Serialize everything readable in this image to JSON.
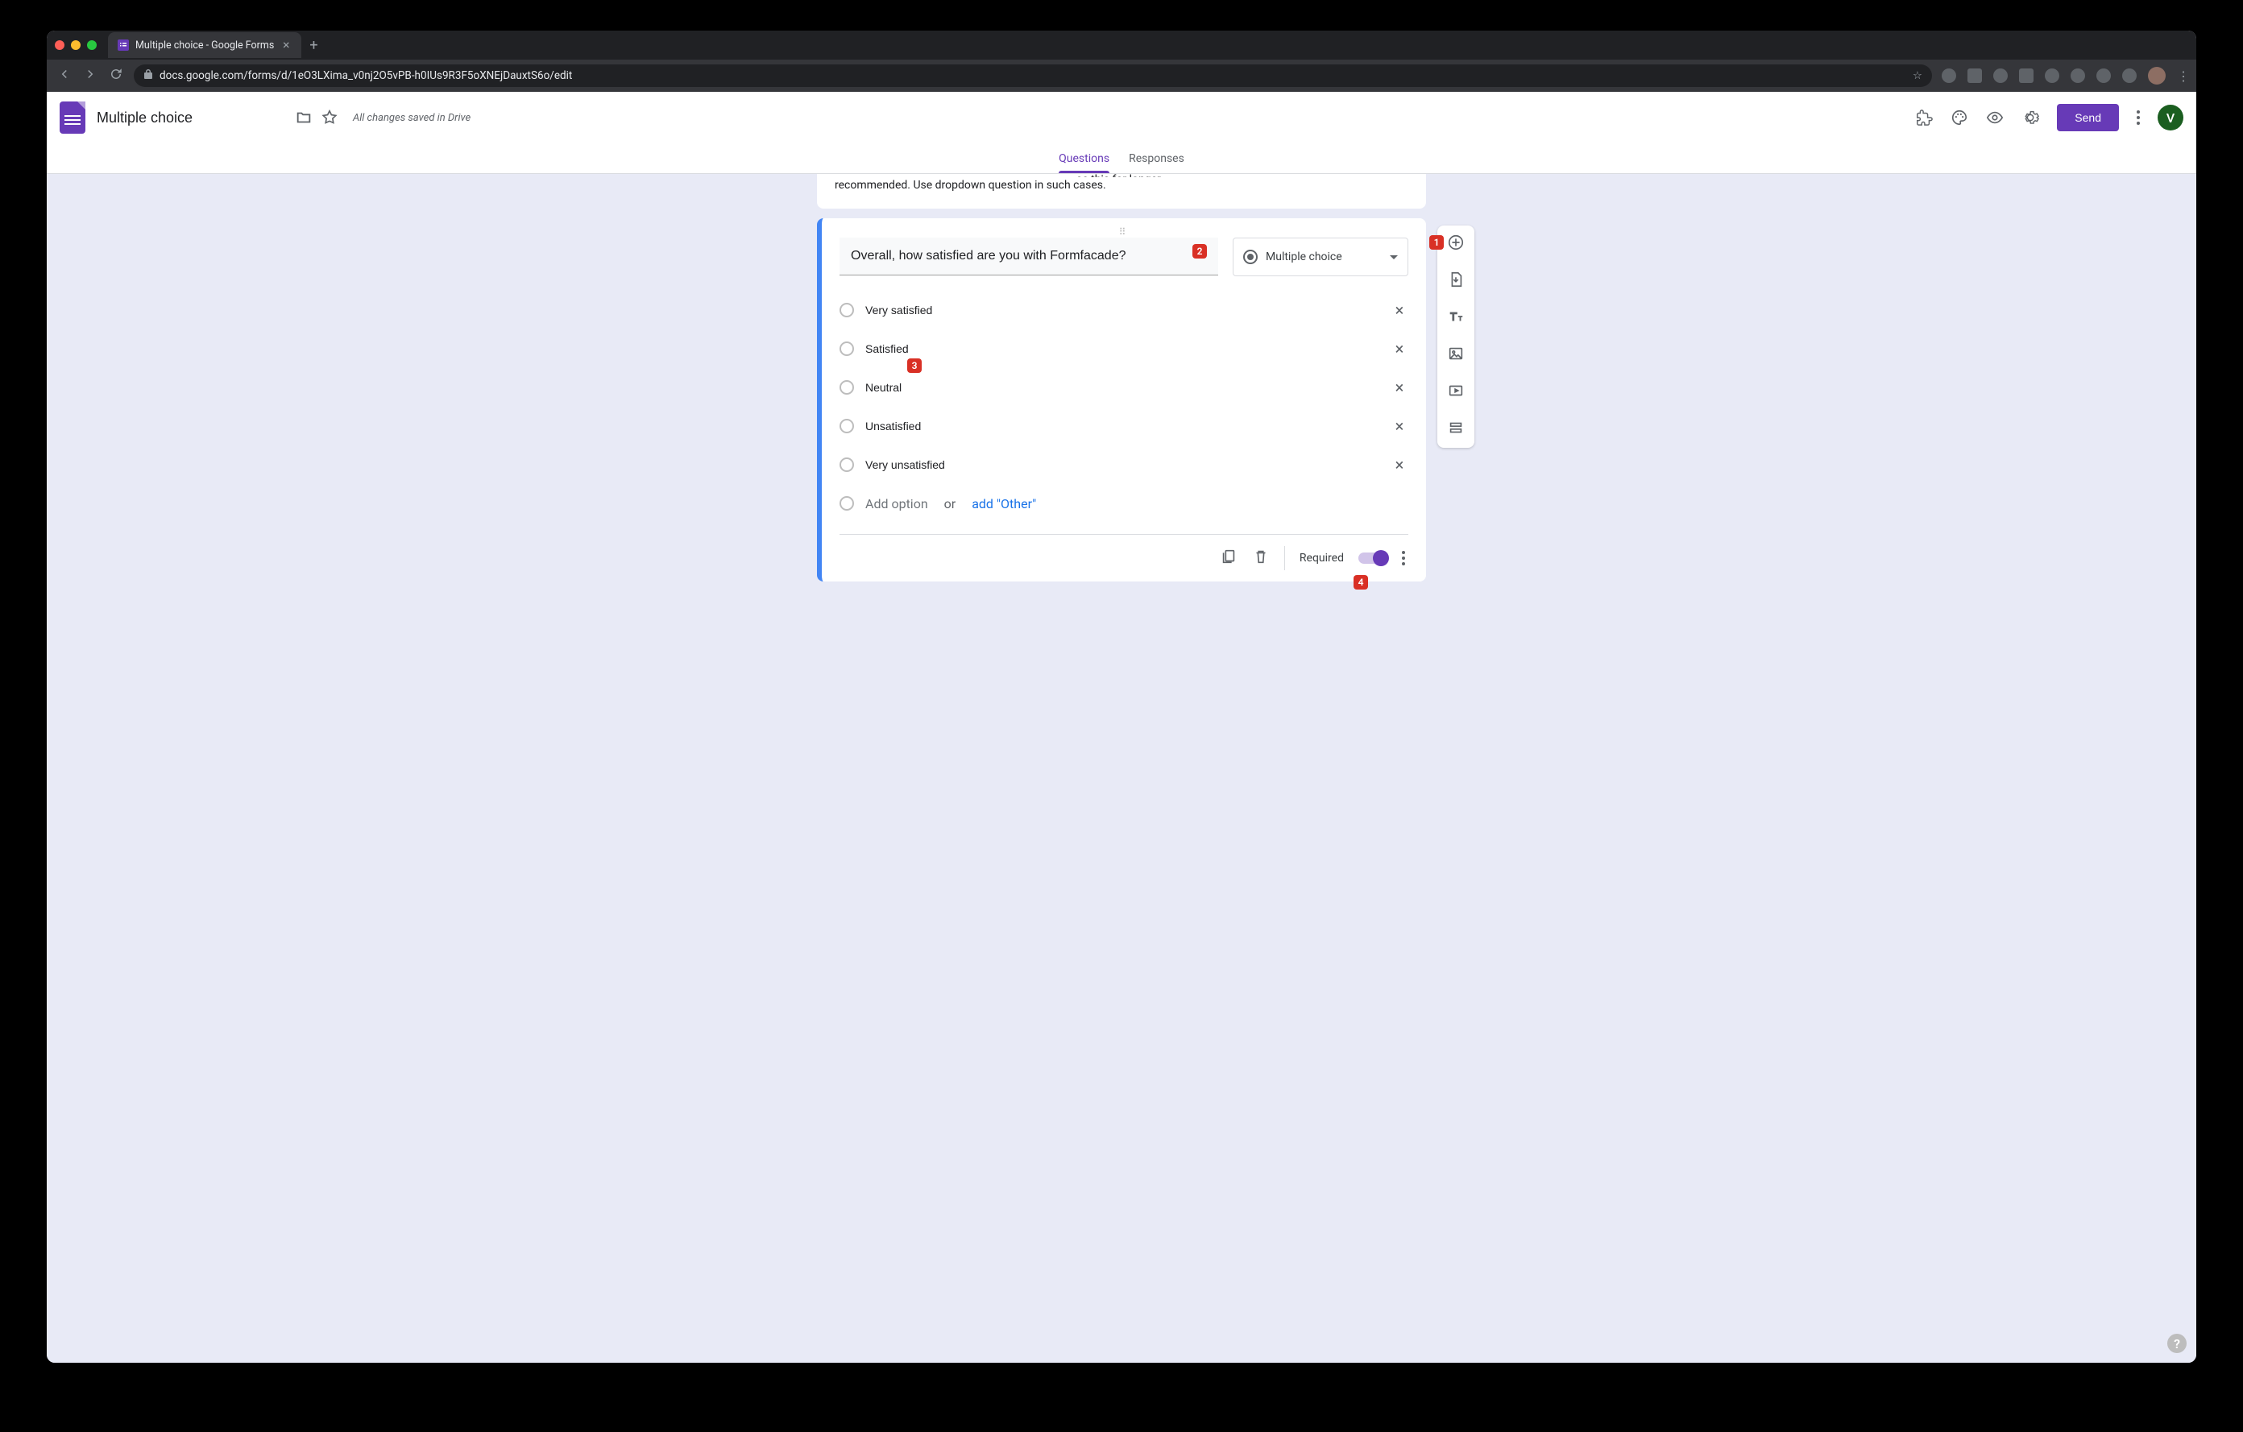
{
  "browser": {
    "tab_title": "Multiple choice - Google Forms",
    "url": "docs.google.com/forms/d/1eO3LXima_v0nj2O5vPB-h0IUs9R3F5oXNEjDauxtS6o/edit"
  },
  "header": {
    "form_title": "Multiple choice",
    "save_status": "All changes saved in Drive",
    "send_label": "Send",
    "avatar_letter": "V"
  },
  "tabs": {
    "questions": "Questions",
    "responses": "Responses"
  },
  "desc_card": {
    "text_fragment": "recommended. Use dropdown question in such cases.",
    "partial_line": "se this for longer"
  },
  "question": {
    "title": "Overall, how satisfied are you with Formfacade?",
    "type_label": "Multiple choice",
    "options": [
      "Very satisfied",
      "Satisfied",
      "Neutral",
      "Unsatisfied",
      "Very unsatisfied"
    ],
    "add_option_placeholder": "Add option",
    "or_label": "or",
    "add_other_label": "add \"Other\"",
    "required_label": "Required"
  },
  "annotations": {
    "b1": "1",
    "b2": "2",
    "b3": "3",
    "b4": "4"
  },
  "help": "?"
}
